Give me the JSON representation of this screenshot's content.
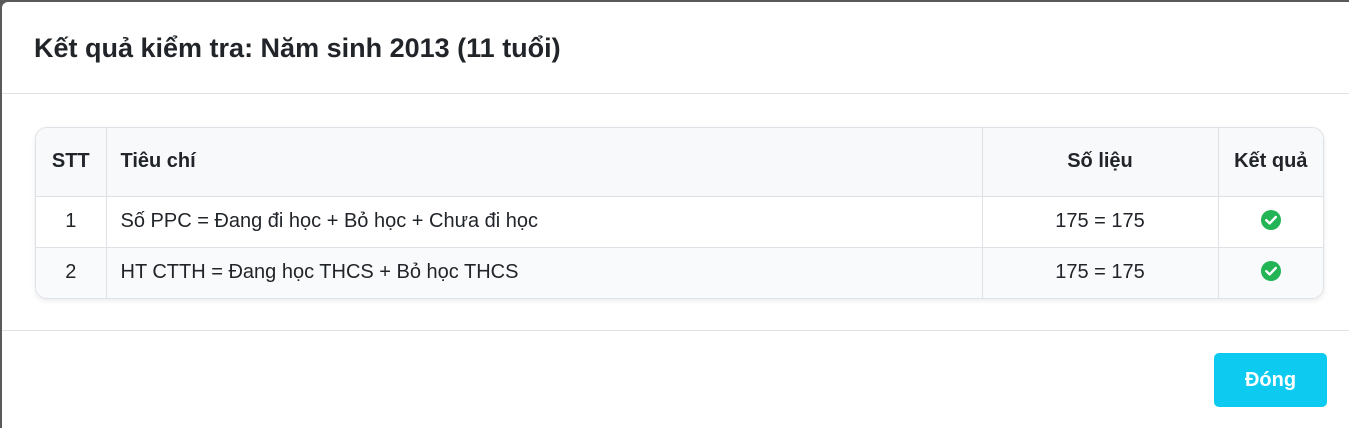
{
  "modal": {
    "title": "Kết quả kiểm tra: Năm sinh 2013 (11 tuổi)"
  },
  "table": {
    "headers": {
      "stt": "STT",
      "criteria": "Tiêu chí",
      "figures": "Số liệu",
      "result": "Kết quả"
    },
    "rows": [
      {
        "stt": "1",
        "criteria": "Số PPC = Đang đi học + Bỏ học + Chưa đi học",
        "figures": "175 = 175",
        "result_icon": "check-circle-icon",
        "result_status": "pass"
      },
      {
        "stt": "2",
        "criteria": "HT CTTH = Đang học THCS + Bỏ học THCS",
        "figures": "175 = 175",
        "result_icon": "check-circle-icon",
        "result_status": "pass"
      }
    ]
  },
  "footer": {
    "close_label": "Đóng"
  },
  "colors": {
    "accent": "#0dcaf0",
    "success": "#22b455"
  }
}
